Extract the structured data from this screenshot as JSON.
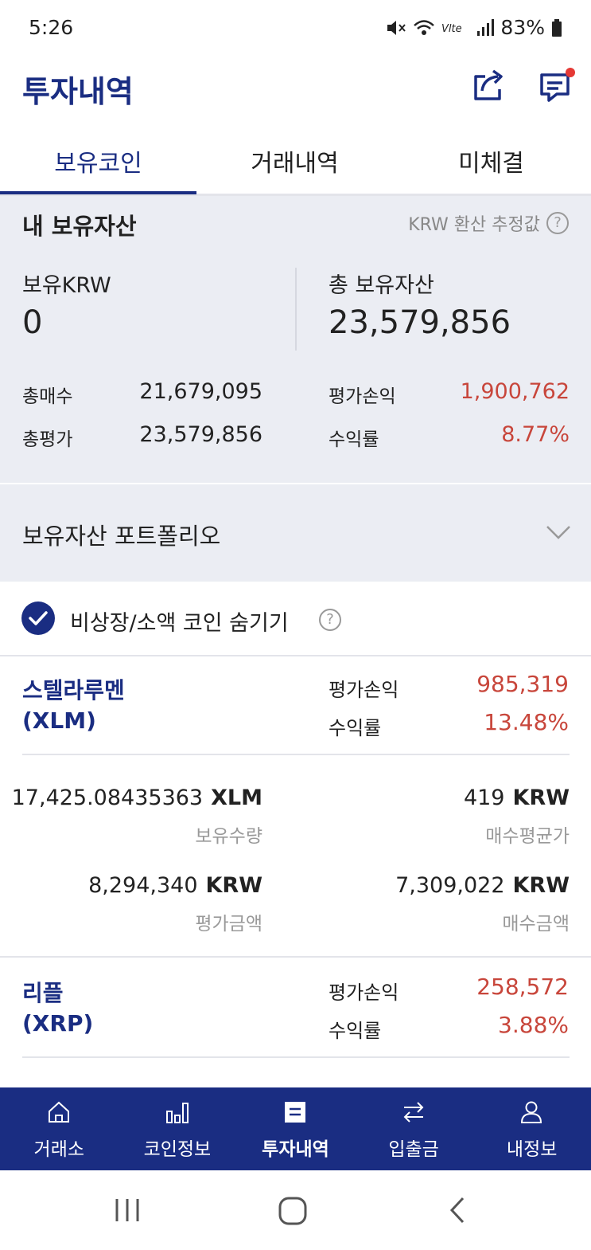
{
  "status_bar": {
    "time": "5:26",
    "battery": "83%"
  },
  "header": {
    "title": "투자내역",
    "share_icon": "share-icon",
    "chat_icon": "chat-icon",
    "notification_color": "#e53935"
  },
  "tabs": [
    {
      "label": "보유코인",
      "active": true
    },
    {
      "label": "거래내역",
      "active": false
    },
    {
      "label": "미체결",
      "active": false
    }
  ],
  "summary": {
    "title": "내 보유자산",
    "estimate_label": "KRW 환산 추정값",
    "krw_label": "보유KRW",
    "krw_value": "0",
    "total_label": "총 보유자산",
    "total_value": "23,579,856",
    "stats": {
      "total_buy_label": "총매수",
      "total_buy_value": "21,679,095",
      "total_eval_label": "총평가",
      "total_eval_value": "23,579,856",
      "pnl_label": "평가손익",
      "pnl_value": "1,900,762",
      "roi_label": "수익률",
      "roi_value": "8.77%"
    },
    "portfolio_label": "보유자산 포트폴리오"
  },
  "filter": {
    "hide_label": "비상장/소액 코인 숨기기",
    "checked": true
  },
  "coins": [
    {
      "name": "스텔라루멘",
      "symbol": "(XLM)",
      "pnl_label": "평가손익",
      "pnl_value": "985,319",
      "roi_label": "수익률",
      "roi_value": "13.48%",
      "holding_amount": "17,425.08435363",
      "holding_unit": "XLM",
      "holding_label": "보유수량",
      "avg_price": "419",
      "avg_price_unit": "KRW",
      "avg_price_label": "매수평균가",
      "eval_amount": "8,294,340",
      "eval_unit": "KRW",
      "eval_label": "평가금액",
      "buy_amount": "7,309,022",
      "buy_unit": "KRW",
      "buy_label": "매수금액"
    },
    {
      "name": "리플",
      "symbol": "(XRP)",
      "pnl_label": "평가손익",
      "pnl_value": "258,572",
      "roi_label": "수익률",
      "roi_value": "3.88%"
    }
  ],
  "bottom_nav": [
    {
      "label": "거래소",
      "icon": "home-icon",
      "active": false
    },
    {
      "label": "코인정보",
      "icon": "bar-chart-icon",
      "active": false
    },
    {
      "label": "투자내역",
      "icon": "document-icon",
      "active": true
    },
    {
      "label": "입출금",
      "icon": "transfer-icon",
      "active": false
    },
    {
      "label": "내정보",
      "icon": "user-icon",
      "active": false
    }
  ],
  "colors": {
    "brand": "#1a2d82",
    "profit": "#c8463b",
    "summary_bg": "#ebedf3"
  }
}
